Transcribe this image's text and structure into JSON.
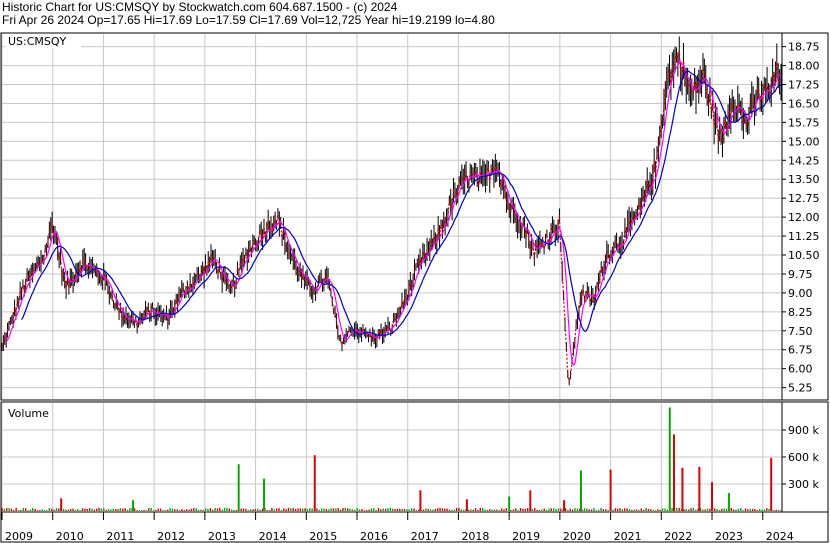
{
  "header": {
    "line1": "Historic Chart for US:CMSQY by Stockwatch.com 604.687.1500 - (c) 2024",
    "line2": "Fri Apr 26 2024   Op=17.65   Hi=17.69   Lo=17.59   Cl=17.69   Vol=12,725   Year hi=19.2199   lo=4.80"
  },
  "price_panel": {
    "symbol_label": "US:CMSQY"
  },
  "volume_panel": {
    "label": "Volume"
  },
  "colors": {
    "price_bars": "#000000",
    "ma_short": "#ff00ff",
    "ma_long": "#0000cc",
    "close_line": "#cc0000",
    "volume_up": "#00aa00",
    "volume_down": "#dd0000",
    "grid": "#c8c8c8"
  },
  "chart_data": [
    {
      "type": "line",
      "title": "",
      "series_kind": "ohlc price bars with moving averages (approximate path read from chart)",
      "x": [
        "2009-01",
        "2009-06",
        "2009-11",
        "2010-01",
        "2010-04",
        "2010-08",
        "2011-01",
        "2011-05",
        "2011-09",
        "2011-12",
        "2012-04",
        "2012-08",
        "2012-12",
        "2013-03",
        "2013-07",
        "2013-11",
        "2014-03",
        "2014-06",
        "2014-09",
        "2014-12",
        "2015-02",
        "2015-06",
        "2015-09",
        "2015-12",
        "2016-05",
        "2016-09",
        "2016-12",
        "2017-04",
        "2017-08",
        "2017-12",
        "2018-03",
        "2018-07",
        "2018-10",
        "2019-01",
        "2019-04",
        "2019-07",
        "2019-10",
        "2020-01",
        "2020-03",
        "2020-06",
        "2020-09",
        "2020-12",
        "2021-04",
        "2021-08",
        "2021-12",
        "2022-02",
        "2022-05",
        "2022-08",
        "2022-11",
        "2023-03",
        "2023-06",
        "2023-09",
        "2023-12",
        "2024-03",
        "2024-04"
      ],
      "series": [
        {
          "values": [
            6.8,
            9.2,
            10.5,
            11.8,
            9.2,
            10.2,
            9.6,
            8.2,
            7.8,
            8.3,
            8.0,
            9.1,
            9.7,
            10.4,
            9.0,
            10.6,
            11.5,
            12.0,
            10.6,
            9.6,
            9.1,
            9.6,
            7.0,
            7.6,
            7.2,
            7.6,
            8.6,
            10.2,
            11.2,
            12.8,
            13.6,
            13.4,
            14.2,
            12.4,
            11.8,
            10.6,
            11.2,
            11.8,
            5.2,
            9.0,
            8.7,
            10.5,
            11.2,
            12.3,
            14.2,
            17.2,
            18.4,
            16.8,
            17.6,
            15.0,
            16.8,
            15.7,
            16.8,
            17.0,
            17.7
          ]
        }
      ],
      "ylim": [
        4.8,
        19.25
      ],
      "y_ticks": [
        "18.75",
        "18.00",
        "17.25",
        "16.50",
        "15.75",
        "15.00",
        "14.25",
        "13.50",
        "12.75",
        "12.00",
        "11.25",
        "10.50",
        "9.75",
        "9.00",
        "8.25",
        "7.50",
        "6.75",
        "6.00",
        "5.25"
      ],
      "x_ticks": [
        "2009",
        "2010",
        "2011",
        "2012",
        "2013",
        "2014",
        "2015",
        "2016",
        "2017",
        "2018",
        "2019",
        "2020",
        "2021",
        "2022",
        "2023",
        "2024"
      ],
      "grid": true
    },
    {
      "type": "bar",
      "title": "Volume",
      "ylim": [
        0,
        1200000
      ],
      "y_ticks": [
        "900 k",
        "600 k",
        "300 k"
      ],
      "spikes": [
        {
          "date": "2010-03",
          "value": 140000,
          "dir": "down"
        },
        {
          "date": "2011-08",
          "value": 120000,
          "dir": "up"
        },
        {
          "date": "2013-09",
          "value": 520000,
          "dir": "up"
        },
        {
          "date": "2014-03",
          "value": 360000,
          "dir": "up"
        },
        {
          "date": "2015-03",
          "value": 620000,
          "dir": "down"
        },
        {
          "date": "2017-04",
          "value": 230000,
          "dir": "down"
        },
        {
          "date": "2018-03",
          "value": 130000,
          "dir": "down"
        },
        {
          "date": "2019-01",
          "value": 160000,
          "dir": "up"
        },
        {
          "date": "2019-06",
          "value": 230000,
          "dir": "down"
        },
        {
          "date": "2020-02",
          "value": 120000,
          "dir": "down"
        },
        {
          "date": "2020-06",
          "value": 450000,
          "dir": "up"
        },
        {
          "date": "2021-01",
          "value": 460000,
          "dir": "down"
        },
        {
          "date": "2022-03",
          "value": 1150000,
          "dir": "up"
        },
        {
          "date": "2022-04",
          "value": 850000,
          "dir": "down"
        },
        {
          "date": "2022-06",
          "value": 480000,
          "dir": "down"
        },
        {
          "date": "2022-10",
          "value": 490000,
          "dir": "down"
        },
        {
          "date": "2023-01",
          "value": 320000,
          "dir": "down"
        },
        {
          "date": "2023-05",
          "value": 200000,
          "dir": "up"
        },
        {
          "date": "2024-03",
          "value": 590000,
          "dir": "down"
        }
      ]
    }
  ]
}
